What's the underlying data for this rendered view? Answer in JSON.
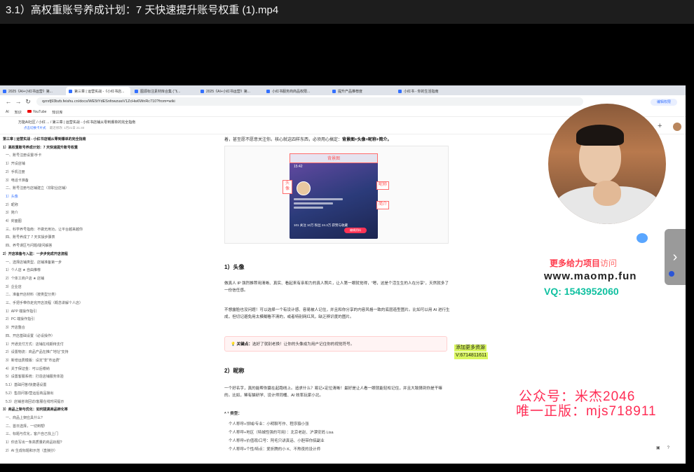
{
  "player": {
    "title": "3.1）高权重账号养成计划：7 天快速提升账号权重 (1).mp4"
  },
  "browser": {
    "tabs": [
      {
        "label": "2025《AI+小红书运营》第...",
        "active": false
      },
      {
        "label": "第三章 | 运营实战 -《小红书店...",
        "active": true
      },
      {
        "label": "图源标注素材库合集 (飞...",
        "active": false
      },
      {
        "label": "2025《AI+小红书运营》第...",
        "active": false
      },
      {
        "label": "小红书服务商商品权限...",
        "active": false
      },
      {
        "label": "提升产品推荐度",
        "active": false
      },
      {
        "label": "小红书 - 你的生活指南",
        "active": false
      }
    ],
    "url": "qzrxfj93bzb.feishu.cn/docs/WE5tYdESnfowzuwV1ZcHw6WnRc710?from=wiki",
    "bookmarks": [
      "AI",
      "知识",
      "YouTube",
      "知识库"
    ]
  },
  "doc_header": {
    "breadcrumb": "万能AI社区  /  小红 ...  /  第三章 | 运营实战 - 小红书店铺从零到爆单的完全指南",
    "sub_link": "点击切换卡片式",
    "sub_meta": "最近修改: 1月21日 21:40",
    "share_label": "编辑权限",
    "plus_label": "+"
  },
  "toc": [
    {
      "text": "第三章 | 运营实战 - 小红书店铺从零到爆单的完全指南",
      "style": "h"
    },
    {
      "text": "1）高权重账号养成计划：7 天快速提升账号权重",
      "style": "h"
    },
    {
      "text": "一、账号注册设置/手卡",
      "style": ""
    },
    {
      "text": "1）开设店铺",
      "style": ""
    },
    {
      "text": "2）手机注册",
      "style": ""
    },
    {
      "text": "3）电话卡准备",
      "style": ""
    },
    {
      "text": "二、账号注册与店铺建立（非职业店铺）",
      "style": ""
    },
    {
      "text": "1）头像",
      "style": "blue"
    },
    {
      "text": "2）昵称",
      "style": ""
    },
    {
      "text": "3）简介",
      "style": ""
    },
    {
      "text": "4）封面图",
      "style": ""
    },
    {
      "text": "三、科学养号指南：不做无用功，让平台越来越你",
      "style": ""
    },
    {
      "text": "四、账号养成了 7 天实操步骤表",
      "style": ""
    },
    {
      "text": "四、养号误区与问题/疑问解答",
      "style": ""
    },
    {
      "text": "2）开店准备与入驻：一步步完成开店流程",
      "style": "h"
    },
    {
      "text": "一、选择店铺类型、店铺准备第一步",
      "style": ""
    },
    {
      "text": "1）个人店 ★ 自由推荐",
      "style": ""
    },
    {
      "text": "2）个体工商户店 ★ 店铺",
      "style": ""
    },
    {
      "text": "3）企业店",
      "style": ""
    },
    {
      "text": "二、准备开店材料（按类型分类）",
      "style": ""
    },
    {
      "text": "三、手把手带你走完开店流程（概念讲解个人店）",
      "style": ""
    },
    {
      "text": "1）APP 端操作指引",
      "style": ""
    },
    {
      "text": "2）PC 端操作指引",
      "style": ""
    },
    {
      "text": "3）开店整合",
      "style": ""
    },
    {
      "text": "四、开店基础设置（必设操作）",
      "style": ""
    },
    {
      "text": "1）开通支付方式：店铺在线期待支付",
      "style": ""
    },
    {
      "text": "2）设置物流：商品产品在推广地址\"支持",
      "style": ""
    },
    {
      "text": "3）新增运费模版：设定\"非\"市运费\"",
      "style": ""
    },
    {
      "text": "4）关于保证金：可以后缴纳",
      "style": ""
    },
    {
      "text": "5）设置客服系统：打造店铺服务体验",
      "style": ""
    },
    {
      "text": "5.1）基础问答/快捷语设置",
      "style": ""
    },
    {
      "text": "5.2）售前问答/营运后商品接出",
      "style": ""
    },
    {
      "text": "5.3）店铺咨询回访/客服在线时间提示",
      "style": ""
    },
    {
      "text": "3）商品上架与优化：如何提高商品转化率",
      "style": "h"
    },
    {
      "text": "一、商品上架应具什么?",
      "style": ""
    },
    {
      "text": "二、首日选择，一切到帮!",
      "style": ""
    },
    {
      "text": "三、标题与优化，客户自己找上门",
      "style": ""
    },
    {
      "text": "1）你去写出一条高质量的商品标题?",
      "style": ""
    },
    {
      "text": "2）AI 生成标题和示范（直接抄）",
      "style": ""
    }
  ],
  "content": {
    "intro_plain": "着，甚至愿不愿意关注你。核心就这四样东西，必须用心搞定：",
    "intro_bold": "背景图+头像+昵称+简介。",
    "figure": {
      "top_label": "背景图",
      "left_label": "头像",
      "right_label_1": "昵称",
      "right_label_2": "简介",
      "phone_time": "15:42",
      "phone_stats": "101 关注   10万 粉丝   24.3万 获赞与收藏",
      "phone_button": "编辑资料"
    },
    "h_avatar": "1）头像",
    "p1": "做真人 IP 强烈推荐用清晰、真实、看起来有亲和力的真人照片，让人第一眼就觉得，\"嗯，这是个活生生的人在分享\"，天然就多了一份信任感。",
    "p2": "不想露脸也没问题！可以选择一个有设计感、容易被人记住，并且和你分享的内容风格一致的底层造型图片。比如可以用 AI 进行生成，但切记避免用太模糊看不清的，或者特别网红风，缺乏辨识度的图片。",
    "callout_icon": "💡",
    "callout_bold": "关键点：",
    "callout_text": "选好了就别老换！让你的头像成为用户记住你的视觉符号。",
    "h_nickname": "2）昵称",
    "p3": "一个好名字，真的能帮你赢在起跑线上。追求什么？易记+定位清晰！最好是让人看一眼就能轻松记住，并且大致猜到你是干嘛的。比如，稀有猫研学、设计师同桶、AI 效率玩家小北。",
    "formula_title": "ᴬ ᵀ 类型：",
    "formulas": [
      "个人称呼+领域/专业：小明聊写作、程序猿小张",
      "个人称呼+地区（特城性强的可用）：北京老赵、沪漂安妈 Lisa",
      "个人称呼+价值观/口号：阿毛只讲真话、小胆带你搞副业",
      "个人称呼+个性/特点：爱折腾的小 K、不熬夜的设计师"
    ]
  },
  "overlay": {
    "promo_line1": "更多给力项目",
    "promo_line1_suffix": "访问",
    "promo_site": "www.maomp.fun",
    "promo_vq": "VQ: 1543952060",
    "wm_small_1": "添加更多资源",
    "wm_small_2": "V:6714811611",
    "wm_public": "公众号：米杰2046",
    "wm_version": "唯一正版：mjs718911",
    "next_icon": "chevron-right-icon"
  }
}
